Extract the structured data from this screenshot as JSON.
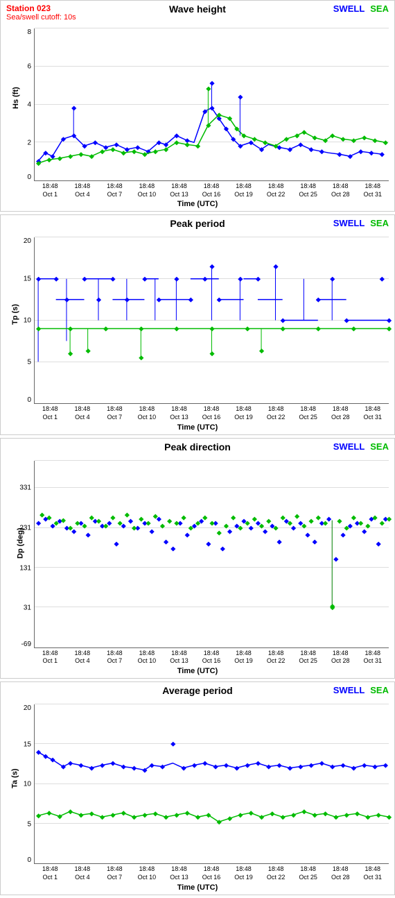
{
  "station": {
    "name": "Station 023",
    "cutoff": "Sea/swell cutoff: 10s"
  },
  "charts": [
    {
      "id": "wave-height",
      "title": "Wave height",
      "y_label": "Hs (ft)",
      "y_min": 0,
      "y_max": 8,
      "y_ticks": [
        0,
        2,
        4,
        6,
        8
      ],
      "x_label": "Time (UTC)"
    },
    {
      "id": "peak-period",
      "title": "Peak period",
      "y_label": "Tp (s)",
      "y_min": 0,
      "y_max": 20,
      "y_ticks": [
        0,
        5,
        10,
        15,
        20
      ],
      "x_label": "Time (UTC)"
    },
    {
      "id": "peak-direction",
      "title": "Peak direction",
      "y_label": "Dp (deg)",
      "y_min": -69,
      "y_max": 400,
      "y_ticks": [
        -69,
        31,
        131,
        231,
        331
      ],
      "x_label": "Time (UTC)"
    },
    {
      "id": "avg-period",
      "title": "Average period",
      "y_label": "Ta (s)",
      "y_min": 0,
      "y_max": 20,
      "y_ticks": [
        0,
        5,
        10,
        15,
        20
      ],
      "x_label": "Time (UTC)"
    }
  ],
  "x_ticks": [
    {
      "time": "18:48",
      "date": "Oct 1"
    },
    {
      "time": "18:48",
      "date": "Oct 4"
    },
    {
      "time": "18:48",
      "date": "Oct 7"
    },
    {
      "time": "18:48",
      "date": "Oct 10"
    },
    {
      "time": "18:48",
      "date": "Oct 13"
    },
    {
      "time": "18:48",
      "date": "Oct 16"
    },
    {
      "time": "18:48",
      "date": "Oct 19"
    },
    {
      "time": "18:48",
      "date": "Oct 22"
    },
    {
      "time": "18:48",
      "date": "Oct 25"
    },
    {
      "time": "18:48",
      "date": "Oct 28"
    },
    {
      "time": "18:48",
      "date": "Oct 31"
    }
  ],
  "legend": {
    "swell": "SWELL",
    "sea": "SEA"
  },
  "colors": {
    "swell": "blue",
    "sea": "#00bb00"
  }
}
